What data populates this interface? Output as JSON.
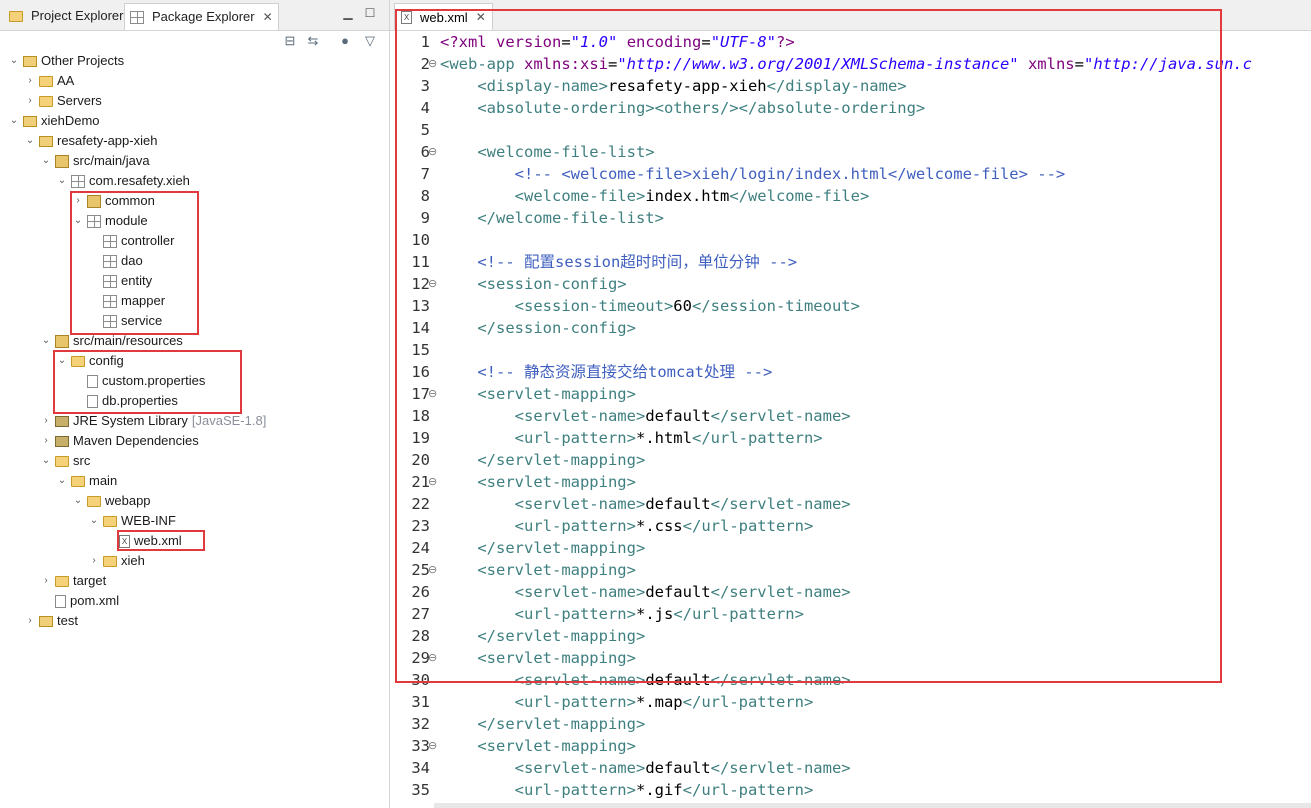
{
  "left_tabs": [
    {
      "label": "Project Explorer",
      "active": false
    },
    {
      "label": "Package Explorer",
      "active": true
    }
  ],
  "tree": [
    {
      "label": "Other Projects",
      "icon": "working-set-icon",
      "twisty": "open"
    },
    {
      "label": "AA",
      "icon": "folder-icon",
      "twisty": "closed"
    },
    {
      "label": "Servers",
      "icon": "folder-icon",
      "twisty": "closed"
    },
    {
      "label": "xiehDemo",
      "icon": "project-icon",
      "twisty": "open"
    },
    {
      "label": "resafety-app-xieh",
      "icon": "maven-project-icon",
      "twisty": "open"
    },
    {
      "label": "src/main/java",
      "icon": "source-folder-icon",
      "twisty": "open"
    },
    {
      "label": "com.resafety.xieh",
      "icon": "package-icon",
      "twisty": "open"
    },
    {
      "label": "common",
      "icon": "package-icon",
      "twisty": "closed"
    },
    {
      "label": "module",
      "icon": "package-icon",
      "twisty": "open"
    },
    {
      "label": "controller",
      "icon": "package-icon",
      "twisty": ""
    },
    {
      "label": "dao",
      "icon": "package-icon",
      "twisty": ""
    },
    {
      "label": "entity",
      "icon": "package-icon",
      "twisty": ""
    },
    {
      "label": "mapper",
      "icon": "package-icon",
      "twisty": ""
    },
    {
      "label": "service",
      "icon": "package-icon",
      "twisty": ""
    },
    {
      "label": "src/main/resources",
      "icon": "source-folder-icon",
      "twisty": "open"
    },
    {
      "label": "config",
      "icon": "folder-icon",
      "twisty": "open"
    },
    {
      "label": "custom.properties",
      "icon": "file-icon",
      "twisty": ""
    },
    {
      "label": "db.properties",
      "icon": "file-icon",
      "twisty": ""
    },
    {
      "label": "JRE System Library",
      "icon": "library-icon",
      "twisty": "closed",
      "decoration": "[JavaSE-1.8]"
    },
    {
      "label": "Maven Dependencies",
      "icon": "library-icon",
      "twisty": "closed"
    },
    {
      "label": "src",
      "icon": "folder-icon",
      "twisty": "open"
    },
    {
      "label": "main",
      "icon": "folder-icon",
      "twisty": "open"
    },
    {
      "label": "webapp",
      "icon": "folder-icon",
      "twisty": "open"
    },
    {
      "label": "WEB-INF",
      "icon": "folder-icon",
      "twisty": "open"
    },
    {
      "label": "web.xml",
      "icon": "xml-file-icon",
      "twisty": ""
    },
    {
      "label": "xieh",
      "icon": "folder-icon",
      "twisty": "closed"
    },
    {
      "label": "target",
      "icon": "folder-icon",
      "twisty": "closed"
    },
    {
      "label": "pom.xml",
      "icon": "maven-file-icon",
      "twisty": ""
    },
    {
      "label": "test",
      "icon": "project-icon",
      "twisty": "closed"
    }
  ],
  "editor_tab": {
    "label": "web.xml"
  },
  "code": [
    {
      "n": "1",
      "fold": "",
      "parts": [
        [
          "pi",
          "<?xml "
        ],
        [
          "attr",
          "version"
        ],
        [
          "txt",
          "="
        ],
        [
          "str",
          "\"1.0\""
        ],
        [
          "txt",
          " "
        ],
        [
          "attr",
          "encoding"
        ],
        [
          "txt",
          "="
        ],
        [
          "str",
          "\"UTF-8\""
        ],
        [
          "pi",
          "?>"
        ]
      ]
    },
    {
      "n": "2",
      "fold": "⊖",
      "parts": [
        [
          "tag",
          "<web-app "
        ],
        [
          "attr",
          "xmlns:xsi"
        ],
        [
          "txt",
          "="
        ],
        [
          "str",
          "\"http://www.w3.org/2001/XMLSchema-instance\""
        ],
        [
          "txt",
          " "
        ],
        [
          "attr",
          "xmlns"
        ],
        [
          "txt",
          "="
        ],
        [
          "str",
          "\"http://java.sun.c"
        ]
      ]
    },
    {
      "n": "3",
      "fold": "",
      "parts": [
        [
          "txt",
          "    "
        ],
        [
          "tag",
          "<display-name>"
        ],
        [
          "txt",
          "resafety-app-xieh"
        ],
        [
          "tag",
          "</display-name>"
        ]
      ]
    },
    {
      "n": "4",
      "fold": "",
      "parts": [
        [
          "txt",
          "    "
        ],
        [
          "tag",
          "<absolute-ordering><others/></absolute-ordering>"
        ]
      ]
    },
    {
      "n": "5",
      "fold": "",
      "parts": []
    },
    {
      "n": "6",
      "fold": "⊖",
      "parts": [
        [
          "txt",
          "    "
        ],
        [
          "tag",
          "<welcome-file-list>"
        ]
      ]
    },
    {
      "n": "7",
      "fold": "",
      "parts": [
        [
          "txt",
          "        "
        ],
        [
          "cmt",
          "<!-- <welcome-file>xieh/login/index.html</welcome-file> -->"
        ]
      ]
    },
    {
      "n": "8",
      "fold": "",
      "parts": [
        [
          "txt",
          "        "
        ],
        [
          "tag",
          "<welcome-file>"
        ],
        [
          "txt",
          "index.htm"
        ],
        [
          "tag",
          "</welcome-file>"
        ]
      ]
    },
    {
      "n": "9",
      "fold": "",
      "parts": [
        [
          "txt",
          "    "
        ],
        [
          "tag",
          "</welcome-file-list>"
        ]
      ]
    },
    {
      "n": "10",
      "fold": "",
      "parts": []
    },
    {
      "n": "11",
      "fold": "",
      "parts": [
        [
          "txt",
          "    "
        ],
        [
          "cmt",
          "<!-- 配置session超时时间，单位分钟 -->"
        ]
      ]
    },
    {
      "n": "12",
      "fold": "⊖",
      "parts": [
        [
          "txt",
          "    "
        ],
        [
          "tag",
          "<session-config>"
        ]
      ]
    },
    {
      "n": "13",
      "fold": "",
      "parts": [
        [
          "txt",
          "        "
        ],
        [
          "tag",
          "<session-timeout>"
        ],
        [
          "txt",
          "60"
        ],
        [
          "tag",
          "</session-timeout>"
        ]
      ]
    },
    {
      "n": "14",
      "fold": "",
      "parts": [
        [
          "txt",
          "    "
        ],
        [
          "tag",
          "</session-config>"
        ]
      ]
    },
    {
      "n": "15",
      "fold": "",
      "parts": []
    },
    {
      "n": "16",
      "fold": "",
      "parts": [
        [
          "txt",
          "    "
        ],
        [
          "cmt",
          "<!-- 静态资源直接交给tomcat处理 -->"
        ]
      ]
    },
    {
      "n": "17",
      "fold": "⊖",
      "parts": [
        [
          "txt",
          "    "
        ],
        [
          "tag",
          "<servlet-mapping>"
        ]
      ]
    },
    {
      "n": "18",
      "fold": "",
      "parts": [
        [
          "txt",
          "        "
        ],
        [
          "tag",
          "<servlet-name>"
        ],
        [
          "txt",
          "default"
        ],
        [
          "tag",
          "</servlet-name>"
        ]
      ]
    },
    {
      "n": "19",
      "fold": "",
      "parts": [
        [
          "txt",
          "        "
        ],
        [
          "tag",
          "<url-pattern>"
        ],
        [
          "txt",
          "*.html"
        ],
        [
          "tag",
          "</url-pattern>"
        ]
      ]
    },
    {
      "n": "20",
      "fold": "",
      "parts": [
        [
          "txt",
          "    "
        ],
        [
          "tag",
          "</servlet-mapping>"
        ]
      ]
    },
    {
      "n": "21",
      "fold": "⊖",
      "parts": [
        [
          "txt",
          "    "
        ],
        [
          "tag",
          "<servlet-mapping>"
        ]
      ]
    },
    {
      "n": "22",
      "fold": "",
      "parts": [
        [
          "txt",
          "        "
        ],
        [
          "tag",
          "<servlet-name>"
        ],
        [
          "txt",
          "default"
        ],
        [
          "tag",
          "</servlet-name>"
        ]
      ]
    },
    {
      "n": "23",
      "fold": "",
      "parts": [
        [
          "txt",
          "        "
        ],
        [
          "tag",
          "<url-pattern>"
        ],
        [
          "txt",
          "*.css"
        ],
        [
          "tag",
          "</url-pattern>"
        ]
      ]
    },
    {
      "n": "24",
      "fold": "",
      "parts": [
        [
          "txt",
          "    "
        ],
        [
          "tag",
          "</servlet-mapping>"
        ]
      ]
    },
    {
      "n": "25",
      "fold": "⊖",
      "parts": [
        [
          "txt",
          "    "
        ],
        [
          "tag",
          "<servlet-mapping>"
        ]
      ]
    },
    {
      "n": "26",
      "fold": "",
      "parts": [
        [
          "txt",
          "        "
        ],
        [
          "tag",
          "<servlet-name>"
        ],
        [
          "txt",
          "default"
        ],
        [
          "tag",
          "</servlet-name>"
        ]
      ]
    },
    {
      "n": "27",
      "fold": "",
      "parts": [
        [
          "txt",
          "        "
        ],
        [
          "tag",
          "<url-pattern>"
        ],
        [
          "txt",
          "*.js"
        ],
        [
          "tag",
          "</url-pattern>"
        ]
      ]
    },
    {
      "n": "28",
      "fold": "",
      "parts": [
        [
          "txt",
          "    "
        ],
        [
          "tag",
          "</servlet-mapping>"
        ]
      ]
    },
    {
      "n": "29",
      "fold": "⊖",
      "parts": [
        [
          "txt",
          "    "
        ],
        [
          "tag",
          "<servlet-mapping>"
        ]
      ]
    },
    {
      "n": "30",
      "fold": "",
      "parts": [
        [
          "txt",
          "        "
        ],
        [
          "tag",
          "<servlet-name>"
        ],
        [
          "txt",
          "default"
        ],
        [
          "tag",
          "</servlet-name>"
        ]
      ]
    },
    {
      "n": "31",
      "fold": "",
      "parts": [
        [
          "txt",
          "        "
        ],
        [
          "tag",
          "<url-pattern>"
        ],
        [
          "txt",
          "*.map"
        ],
        [
          "tag",
          "</url-pattern>"
        ]
      ]
    },
    {
      "n": "32",
      "fold": "",
      "parts": [
        [
          "txt",
          "    "
        ],
        [
          "tag",
          "</servlet-mapping>"
        ]
      ]
    },
    {
      "n": "33",
      "fold": "⊖",
      "parts": [
        [
          "txt",
          "    "
        ],
        [
          "tag",
          "<servlet-mapping>"
        ]
      ]
    },
    {
      "n": "34",
      "fold": "",
      "parts": [
        [
          "txt",
          "        "
        ],
        [
          "tag",
          "<servlet-name>"
        ],
        [
          "txt",
          "default"
        ],
        [
          "tag",
          "</servlet-name>"
        ]
      ]
    },
    {
      "n": "35",
      "fold": "",
      "parts": [
        [
          "txt",
          "        "
        ],
        [
          "tag",
          "<url-pattern>"
        ],
        [
          "txt",
          "*.gif"
        ],
        [
          "tag",
          "</url-pattern>"
        ]
      ]
    }
  ],
  "colors": {
    "highlight_box": "#e0393e",
    "xml_tag": "#3f7f7f",
    "xml_attr": "#7f007f",
    "xml_string": "#2a00ff",
    "xml_comment": "#3f5fbf"
  }
}
